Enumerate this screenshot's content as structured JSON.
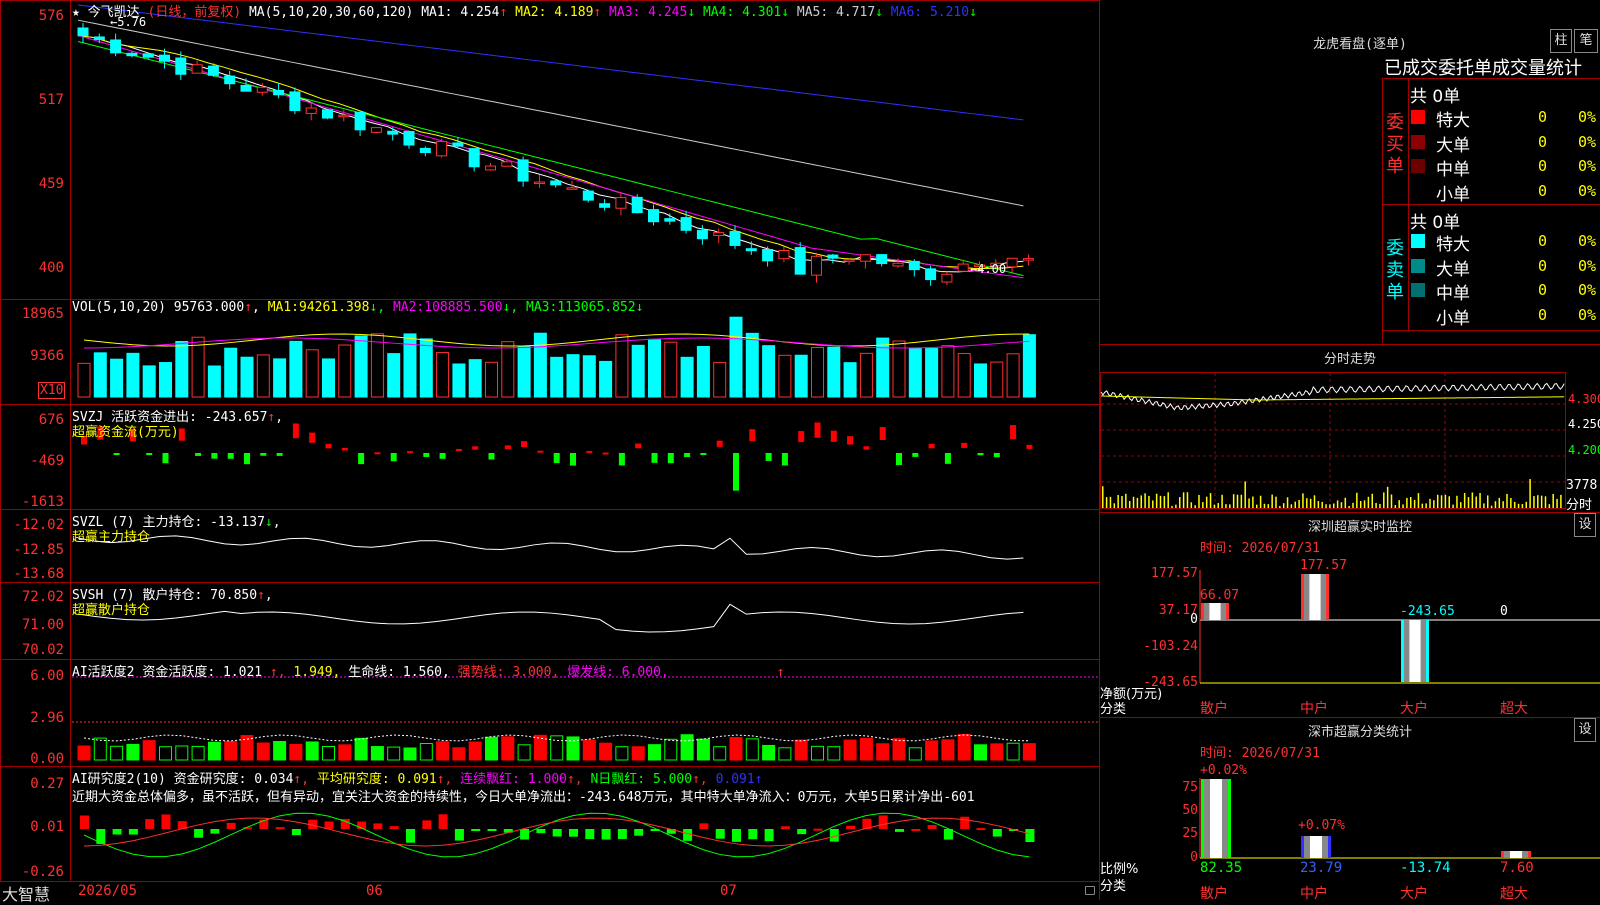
{
  "stock": {
    "name": "今飞凯达",
    "period": "(日线，前复权)",
    "ma_label": "MA(5,10,20,30,60,120)",
    "ma_values": [
      {
        "label": "MA1:",
        "value": "4.254",
        "arrow": "↑",
        "color": "#ffffff"
      },
      {
        "label": "MA2:",
        "value": "4.189",
        "arrow": "↑",
        "color": "#ffff00"
      },
      {
        "label": "MA3:",
        "value": "4.245",
        "arrow": "↓",
        "color": "#ff00ff"
      },
      {
        "label": "MA4:",
        "value": "4.301",
        "arrow": "↓",
        "color": "#00ff00"
      },
      {
        "label": "MA5:",
        "value": "4.717",
        "arrow": "↓",
        "color": "#cccccc"
      },
      {
        "label": "MA6:",
        "value": "5.210",
        "arrow": "↓",
        "color": "#3030ff"
      }
    ],
    "high_mark": "5.76",
    "low_mark": "4.00"
  },
  "price_axis": [
    "576",
    "517",
    "459",
    "400"
  ],
  "volume": {
    "title": "VOL(5,10,20)",
    "value": "95763.000",
    "ma": [
      {
        "label": "MA1:",
        "value": "94261.398",
        "color": "#ffff00"
      },
      {
        "label": "MA2:",
        "value": "108885.500",
        "color": "#ff00ff"
      },
      {
        "label": "MA3:",
        "value": "113065.852",
        "color": "#00ff00"
      }
    ],
    "axis": [
      "18965",
      "9366"
    ],
    "unit": "X10"
  },
  "svzj": {
    "title": "SVZJ",
    "line1": "活跃资金进出:",
    "value": "-243.657",
    "sub": "超赢资金流(万元)",
    "axis": [
      "676",
      "-469",
      "-1613"
    ]
  },
  "svzl": {
    "title": "SVZL (7)",
    "line1": "主力持仓:",
    "value": "-13.137",
    "sub": "超赢主力持仓",
    "axis": [
      "-12.02",
      "-12.85",
      "-13.68"
    ]
  },
  "svsh": {
    "title": "SVSH (7)",
    "line1": "散户持仓:",
    "value": "70.850",
    "sub": "超赢散户持仓",
    "axis": [
      "72.02",
      "71.00",
      "70.02"
    ]
  },
  "ai_active": {
    "title": "AI活跃度2",
    "parts": [
      {
        "text": "资金活跃度:",
        "color": "#ffffff"
      },
      {
        "text": "1.021",
        "color": "#ffffff"
      },
      {
        "text": "↑,",
        "color": "#ff3030"
      },
      {
        "text": "1.949,",
        "color": "#ffff00"
      },
      {
        "text": "生命线:",
        "color": "#ffffff"
      },
      {
        "text": "1.560,",
        "color": "#ffffff"
      },
      {
        "text": "强势线:",
        "color": "#ff3030"
      },
      {
        "text": "3.000,",
        "color": "#ff3030"
      },
      {
        "text": "爆发线:",
        "color": "#ff00ff"
      },
      {
        "text": "6.000,",
        "color": "#ff00ff"
      }
    ],
    "axis": [
      "6.00",
      "2.96",
      "0.00"
    ]
  },
  "ai_research": {
    "title": "AI研究度2(10)",
    "parts": [
      {
        "text": "资金研究度:",
        "color": "#ffffff"
      },
      {
        "text": "0.034",
        "color": "#ffffff"
      },
      {
        "text": "↑,",
        "color": "#ff3030"
      },
      {
        "text": "平均研究度:",
        "color": "#ffff00"
      },
      {
        "text": "0.091",
        "color": "#ffff00"
      },
      {
        "text": "↑,",
        "color": "#ff3030"
      },
      {
        "text": "连续飘红:",
        "color": "#ff00ff"
      },
      {
        "text": "1.000",
        "color": "#ff00ff"
      },
      {
        "text": "↑,",
        "color": "#ff3030"
      },
      {
        "text": "N日飘红:",
        "color": "#00ff00"
      },
      {
        "text": "5.000",
        "color": "#00ff00"
      },
      {
        "text": "↑,",
        "color": "#ff3030"
      },
      {
        "text": "0.091",
        "color": "#3030ff"
      },
      {
        "text": "↑",
        "color": "#3030ff"
      }
    ],
    "comment": "近期大资金总体偏多，虽不活跃，但有异动，宜关注大资金的持续性，今日大单净流出：-243.648万元，其中特大单净流入：0万元，大单5日累计净出-601",
    "axis": [
      "0.27",
      "0.01",
      "-0.26"
    ]
  },
  "date_axis": [
    "2026/05",
    "06",
    "07"
  ],
  "app_name": "大智慧",
  "right": {
    "dragon_title": "龙虎看盘(逐单)",
    "btn_zhu": "柱",
    "btn_bi": "笔",
    "stats_title": "已成交委托单成交量统计",
    "buy": {
      "side": "委买单",
      "total": "共 0单",
      "rows": [
        {
          "label": "特大",
          "val": "0",
          "pct": "0%",
          "color": "#ff0000"
        },
        {
          "label": "大单",
          "val": "0",
          "pct": "0%",
          "color": "#8b0000"
        },
        {
          "label": "中单",
          "val": "0",
          "pct": "0%",
          "color": "#6b0000"
        },
        {
          "label": "小单",
          "val": "0",
          "pct": "0%",
          "color": "#000000"
        }
      ]
    },
    "sell": {
      "side": "委卖单",
      "total": "共 0单",
      "rows": [
        {
          "label": "特大",
          "val": "0",
          "pct": "0%",
          "color": "#00ffff"
        },
        {
          "label": "大单",
          "val": "0",
          "pct": "0%",
          "color": "#008b8b"
        },
        {
          "label": "中单",
          "val": "0",
          "pct": "0%",
          "color": "#007070"
        },
        {
          "label": "小单",
          "val": "0",
          "pct": "0%",
          "color": "#000000"
        }
      ]
    },
    "fenshi": {
      "title": "分时走势",
      "axis": [
        "4.300",
        "4.250",
        "4.200"
      ],
      "vol_axis": "3778",
      "vol_label": "分时"
    },
    "monitor": {
      "title": "深圳超赢实时监控",
      "btn": "设",
      "time": "时间: 2026/07/31",
      "axis": [
        "177.57",
        "37.17",
        "0",
        "-103.24",
        "-243.65"
      ],
      "bar_labels": [
        "66.07",
        "177.57",
        "-243.65",
        "0"
      ],
      "y_label": "净额(万元)",
      "x_title": "分类",
      "cats": [
        "散户",
        "中户",
        "大户",
        "超大"
      ]
    },
    "classify": {
      "title": "深市超赢分类统计",
      "btn": "设",
      "time": "时间: 2026/07/31",
      "axis": [
        "75",
        "50",
        "25",
        "0"
      ],
      "top_labels": [
        "+0.02%",
        "+0.07%"
      ],
      "y_label": "比例%",
      "x_title": "分类",
      "values": [
        "82.35",
        "23.79",
        "-13.74",
        "7.60"
      ],
      "cats": [
        "散户",
        "中户",
        "大户",
        "超大"
      ]
    }
  }
}
